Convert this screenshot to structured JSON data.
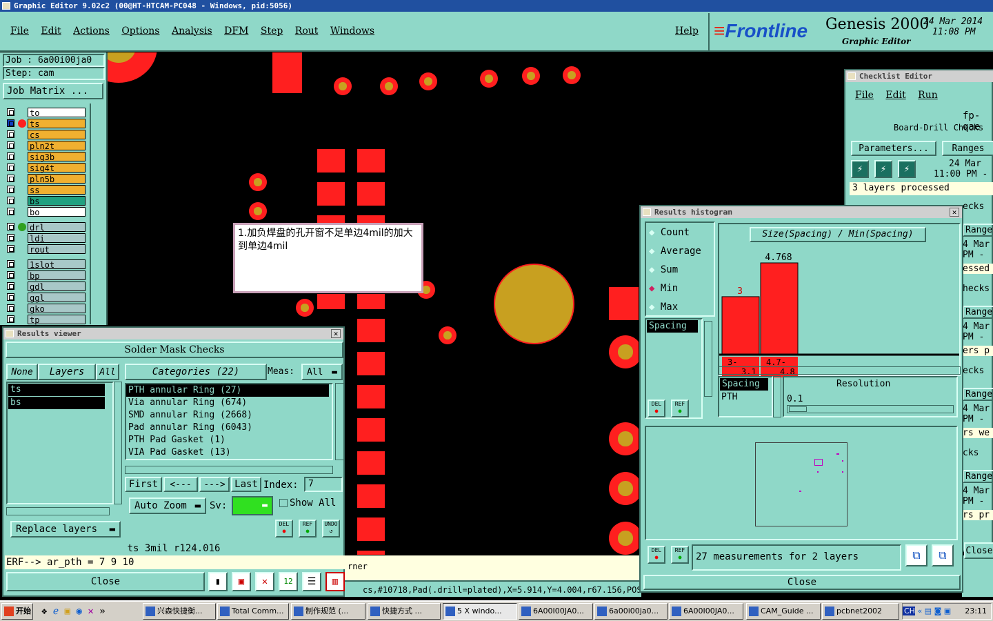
{
  "window_title": "Graphic Editor 9.02c2 (00@HT-HTCAM-PC048 - Windows, pid:5056)",
  "menu": [
    "File",
    "Edit",
    "Actions",
    "Options",
    "Analysis",
    "DFM",
    "Step",
    "Rout",
    "Windows"
  ],
  "help": "Help",
  "brand": {
    "logo": "Frontline",
    "product": "Genesis 2000",
    "subtitle": "Graphic Editor",
    "date": "24 Mar 2014",
    "time": "11:08 PM"
  },
  "job": {
    "job_label": "Job : 6a00i00ja0",
    "step_label": "Step: cam",
    "matrix_button": "Job Matrix ..."
  },
  "layers": [
    {
      "name": "to",
      "color": "#ffffff"
    },
    {
      "name": "ts",
      "color": "#f0b030"
    },
    {
      "name": "cs",
      "color": "#f0b030"
    },
    {
      "name": "pln2t",
      "color": "#f0b030"
    },
    {
      "name": "sig3b",
      "color": "#f0b030"
    },
    {
      "name": "sig4t",
      "color": "#f0b030"
    },
    {
      "name": "pln5b",
      "color": "#f0b030"
    },
    {
      "name": "ss",
      "color": "#f0b030"
    },
    {
      "name": "bs",
      "color": "#20a080"
    },
    {
      "name": "bo",
      "color": "#ffffff"
    },
    {
      "name": "drl",
      "color": "#a8c8c8"
    },
    {
      "name": "ldi",
      "color": "#a8c8c8"
    },
    {
      "name": "rout",
      "color": "#a8c8c8"
    },
    {
      "name": "1slot",
      "color": "#a8c8c8"
    },
    {
      "name": "bp",
      "color": "#a8c8c8"
    },
    {
      "name": "gdl",
      "color": "#a8c8c8"
    },
    {
      "name": "ggl",
      "color": "#a8c8c8"
    },
    {
      "name": "gko",
      "color": "#a8c8c8"
    },
    {
      "name": "tp",
      "color": "#a8c8c8"
    }
  ],
  "note": "1.加负焊盘的孔开窗不足单边4mil的加大到单边4mil",
  "results_viewer": {
    "title": "Results viewer",
    "header": "Solder Mask Checks",
    "none": "None",
    "layers": "Layers",
    "all": "All",
    "categories": "Categories (22)",
    "meas_label": "Meas:",
    "meas_value": "All",
    "layer_items": [
      "ts",
      "bs"
    ],
    "category_items": [
      "PTH annular Ring (27)",
      "Via annular Ring (674)",
      "SMD annular Ring (2668)",
      "Pad annular Ring (6043)",
      "PTH Pad Gasket (1)",
      "VIA Pad Gasket (13)"
    ],
    "first": "First",
    "prev": "<---",
    "next": "--->",
    "last": "Last",
    "index_label": "Index:",
    "index_value": "7",
    "auto_zoom": "Auto Zoom",
    "sv": "Sv:",
    "show_all": "Show All",
    "replace_layers": "Replace layers",
    "status": "ts 3mil   r124.016",
    "erf": "ERF--> ar_pth = 7 9 10",
    "close": "Close",
    "del": "DEL",
    "ref": "REF",
    "undo": "UNDO"
  },
  "histogram": {
    "title": "Results histogram",
    "options": [
      "Count",
      "Average",
      "Sum",
      "Min",
      "Max"
    ],
    "selected": "Min",
    "chart_title": "Size(Spacing) / Min(Spacing)",
    "list_item": "Spacing",
    "bars": [
      {
        "label": "3",
        "range": "3-\n3.1",
        "value": 3
      },
      {
        "label": "4.768",
        "range": "4.7-\n4.8",
        "value": 4.768
      }
    ],
    "field1": "Spacing",
    "field2": "PTH",
    "resolution_label": "Resolution",
    "resolution_value": "0.1",
    "measurements": "27 measurements for 2 layers",
    "close": "Close",
    "del": "DEL",
    "ref": "REF"
  },
  "checklist": {
    "title": "Checklist Editor",
    "menu": [
      "File",
      "Edit",
      "Run"
    ],
    "name": "fp-qae",
    "row_label": "Board-Drill Checks",
    "parameters": "Parameters...",
    "ranges": "Ranges",
    "date": "24 Mar",
    "time": "11:00 PM -",
    "processed": "3 layers processed",
    "side_items": [
      "ecks",
      "Ranges",
      "4 Mar",
      "PM -",
      "essed",
      "hecks",
      "Ranges",
      "4 Mar",
      "PM -",
      "ers p",
      "ecks",
      "Ranges",
      "4 Mar",
      "PM -",
      "rs we",
      "cks",
      "Ranges",
      "4 Mar",
      "PM -",
      "rs pr"
    ],
    "close": "Close",
    "partial": "h"
  },
  "statusbar": {
    "left": "rner",
    "coords": "cs,#10718,Pad(.drill=plated),X=5.914,Y=4.004,r67.156,POS"
  },
  "taskbar": {
    "start": "开始",
    "items": [
      "兴森快捷衡...",
      "Total Comm...",
      "制作规范 (...",
      "快捷方式 ...",
      "5 X windo...",
      "6A00I00JA0...",
      "6a00i00ja0...",
      "6A00I00JA0...",
      "CAM_Guide ...",
      "pcbnet2002"
    ],
    "clock": "23:11",
    "lang": "CH"
  }
}
